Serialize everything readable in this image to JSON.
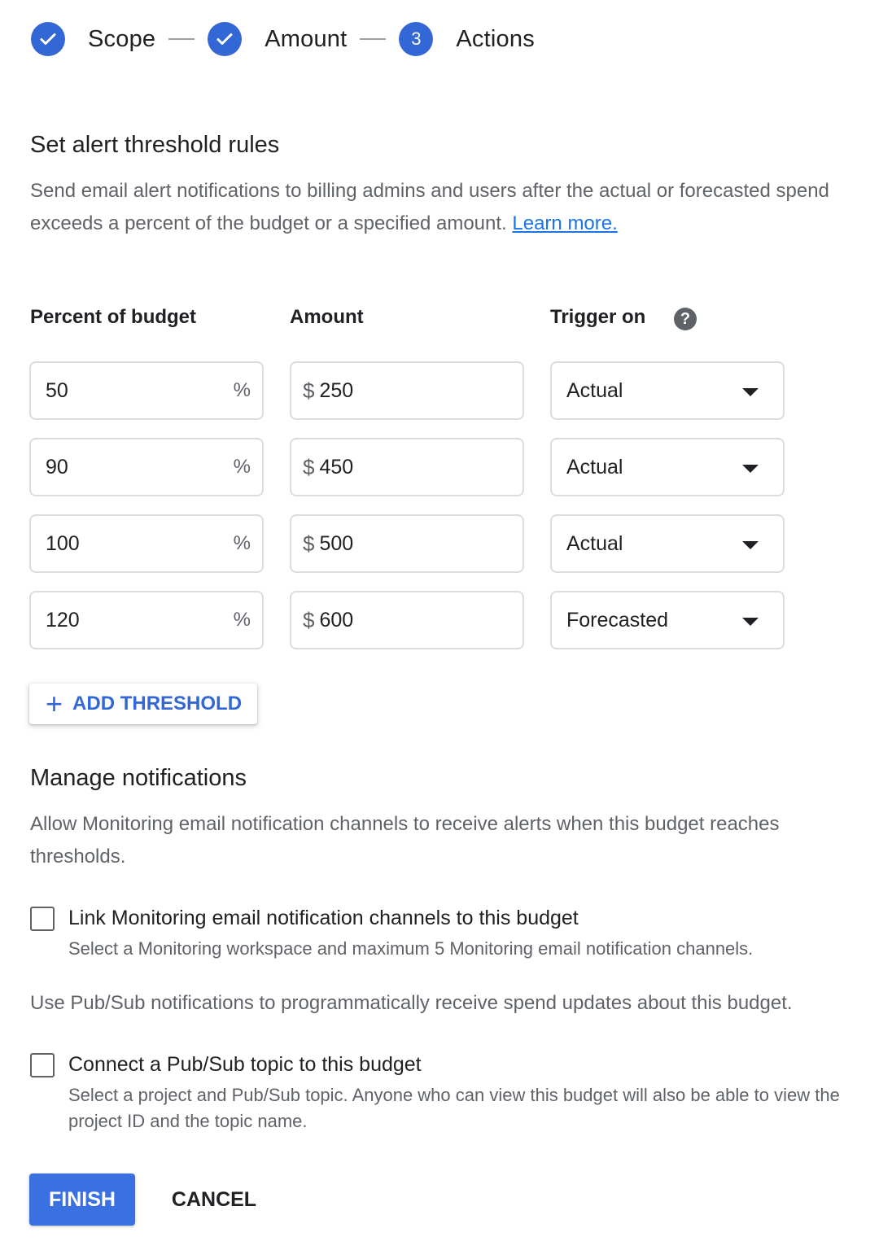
{
  "stepper": {
    "steps": [
      {
        "label": "Scope",
        "state": "completed",
        "marker": "check-icon"
      },
      {
        "label": "Amount",
        "state": "completed",
        "marker": "check-icon"
      },
      {
        "label": "Actions",
        "state": "current",
        "number": "3"
      }
    ]
  },
  "alerts": {
    "title": "Set alert threshold rules",
    "description": "Send email alert notifications to billing admins and users after the actual or forecasted spend exceeds a percent of the budget or a specified amount.",
    "learn_more": "Learn more.",
    "columns": {
      "percent": "Percent of budget",
      "amount": "Amount",
      "trigger": "Trigger on"
    },
    "help_icon": "?",
    "percent_suffix": "%",
    "currency_prefix": "$",
    "rows": [
      {
        "percent": "50",
        "amount": "250",
        "trigger": "Actual"
      },
      {
        "percent": "90",
        "amount": "450",
        "trigger": "Actual"
      },
      {
        "percent": "100",
        "amount": "500",
        "trigger": "Actual"
      },
      {
        "percent": "120",
        "amount": "600",
        "trigger": "Forecasted"
      }
    ],
    "add_threshold": "ADD THRESHOLD"
  },
  "notifications": {
    "title": "Manage notifications",
    "description": "Allow Monitoring email notification channels to receive alerts when this budget reaches thresholds.",
    "monitoring": {
      "label": "Link Monitoring email notification channels to this budget",
      "sub": "Select a Monitoring workspace and maximum 5 Monitoring email notification channels.",
      "checked": false
    },
    "pubsub_intro": "Use Pub/Sub notifications to programmatically receive spend updates about this budget.",
    "pubsub": {
      "label": "Connect a Pub/Sub topic to this budget",
      "sub": "Select a project and Pub/Sub topic. Anyone who can view this budget will also be able to view the project ID and the topic name.",
      "checked": false
    }
  },
  "actions": {
    "finish": "FINISH",
    "cancel": "CANCEL"
  },
  "colors": {
    "primary": "#3367d6",
    "link": "#1a73e8",
    "text": "#202124",
    "secondary_text": "#5f6368",
    "border": "#dadce0"
  }
}
